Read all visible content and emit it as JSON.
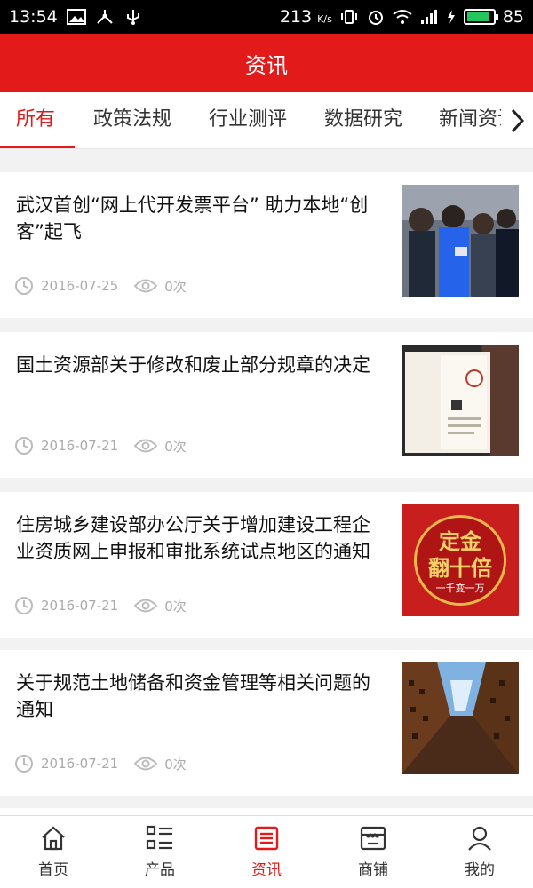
{
  "status_bar": {
    "time": "13:54",
    "speed": "213",
    "speed_unit": "K/s",
    "battery": "85",
    "battery_level": 0.85
  },
  "header": {
    "title": "资讯"
  },
  "tabs": [
    {
      "label": "所有",
      "active": true
    },
    {
      "label": "政策法规",
      "active": false
    },
    {
      "label": "行业测评",
      "active": false
    },
    {
      "label": "数据研究",
      "active": false
    },
    {
      "label": "新闻资讯",
      "active": false
    }
  ],
  "articles": [
    {
      "title": "武汉首创“网上代开发票平台” 助力本地“创客”起飞",
      "date": "2016-07-25",
      "views": "0次",
      "thumb_icon": "crowd-photo"
    },
    {
      "title": "国土资源部关于修改和废止部分规章的决定",
      "date": "2016-07-21",
      "views": "0次",
      "thumb_icon": "certificate-photo"
    },
    {
      "title": "住房城乡建设部办公厅关于增加建设工程企业资质网上申报和审批系统试点地区的通知",
      "date": "2016-07-21",
      "views": "0次",
      "thumb_icon": "promo-badge-photo",
      "thumb_text": "定金",
      "thumb_text2": "翻十倍",
      "thumb_text3": "一千变一万"
    },
    {
      "title": "关于规范土地储备和资金管理等相关问题的通知",
      "date": "2016-07-21",
      "views": "0次",
      "thumb_icon": "buildings-sky-photo"
    }
  ],
  "bottom_nav": [
    {
      "label": "首页",
      "icon": "home-icon",
      "active": false
    },
    {
      "label": "产品",
      "icon": "grid-list-icon",
      "active": false
    },
    {
      "label": "资讯",
      "icon": "news-icon",
      "active": true
    },
    {
      "label": "商铺",
      "icon": "shop-icon",
      "active": false
    },
    {
      "label": "我的",
      "icon": "user-icon",
      "active": false
    }
  ],
  "colors": {
    "brand_red": "#e21a1a",
    "meta_gray": "#aaaaaa"
  }
}
